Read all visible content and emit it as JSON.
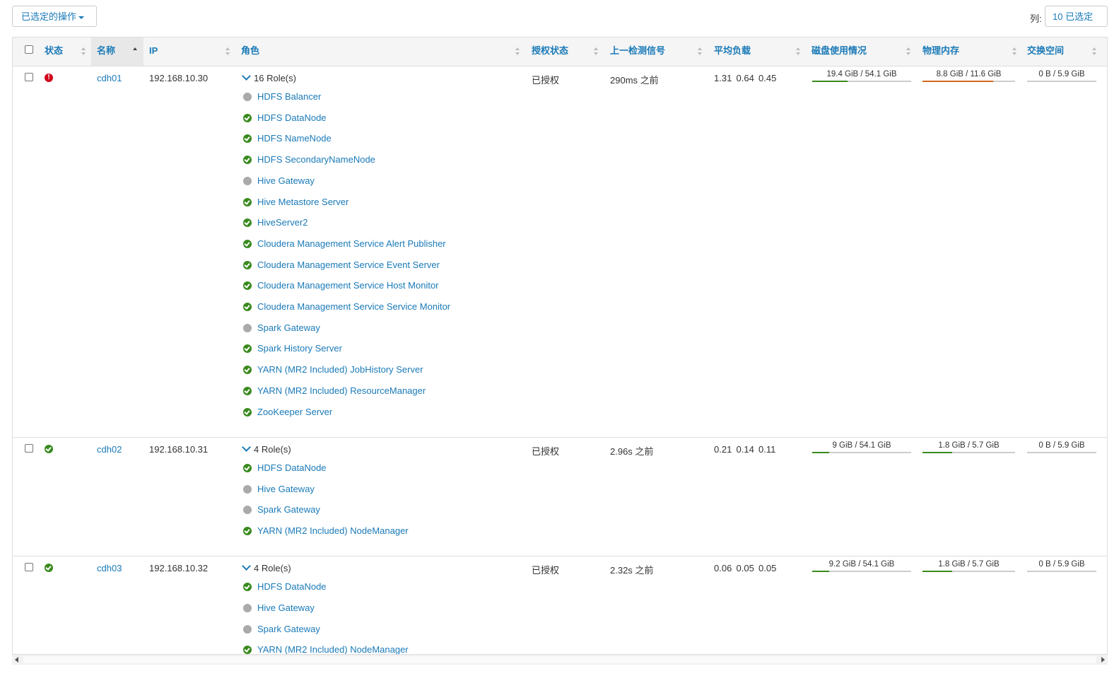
{
  "toolbar": {
    "actions_label": "已选定的操作",
    "columns_label": "列:",
    "columns_button": "10 已选定"
  },
  "headers": {
    "status": "状态",
    "name": "名称",
    "ip": "IP",
    "roles": "角色",
    "auth": "授权状态",
    "heartbeat": "上一检测信号",
    "load": "平均负载",
    "disk": "磁盘使用情况",
    "memory": "物理内存",
    "swap": "交换空间"
  },
  "colors": {
    "link": "#1a7ab8",
    "ok": "#3a8a1e",
    "error": "#d0021b",
    "inactive": "#aaaaaa",
    "bar_green": "#3a8a1e",
    "bar_orange": "#d2691e"
  },
  "hosts": [
    {
      "status": "error",
      "name": "cdh01",
      "ip": "192.168.10.30",
      "roles_summary": "16 Role(s)",
      "roles": [
        {
          "name": "HDFS Balancer",
          "state": "gray"
        },
        {
          "name": "HDFS DataNode",
          "state": "ok"
        },
        {
          "name": "HDFS NameNode",
          "state": "ok"
        },
        {
          "name": "HDFS SecondaryNameNode",
          "state": "ok"
        },
        {
          "name": "Hive Gateway",
          "state": "gray"
        },
        {
          "name": "Hive Metastore Server",
          "state": "ok"
        },
        {
          "name": "HiveServer2",
          "state": "ok"
        },
        {
          "name": "Cloudera Management Service Alert Publisher",
          "state": "ok"
        },
        {
          "name": "Cloudera Management Service Event Server",
          "state": "ok"
        },
        {
          "name": "Cloudera Management Service Host Monitor",
          "state": "ok"
        },
        {
          "name": "Cloudera Management Service Service Monitor",
          "state": "ok"
        },
        {
          "name": "Spark Gateway",
          "state": "gray"
        },
        {
          "name": "Spark History Server",
          "state": "ok"
        },
        {
          "name": "YARN (MR2 Included) JobHistory Server",
          "state": "ok"
        },
        {
          "name": "YARN (MR2 Included) ResourceManager",
          "state": "ok"
        },
        {
          "name": "ZooKeeper Server",
          "state": "ok"
        }
      ],
      "auth": "已授权",
      "heartbeat": "290ms 之前",
      "load": [
        "1.31",
        "0.64",
        "0.45"
      ],
      "disk": {
        "text": "19.4 GiB / 54.1 GiB",
        "fraction": 0.36,
        "color": "#3a8a1e"
      },
      "memory": {
        "text": "8.8 GiB / 11.6 GiB",
        "fraction": 0.76,
        "color": "#d2691e"
      },
      "swap": {
        "text": "0 B / 5.9 GiB",
        "fraction": 0.0,
        "color": "#3a8a1e"
      }
    },
    {
      "status": "ok",
      "name": "cdh02",
      "ip": "192.168.10.31",
      "roles_summary": "4 Role(s)",
      "roles": [
        {
          "name": "HDFS DataNode",
          "state": "ok"
        },
        {
          "name": "Hive Gateway",
          "state": "gray"
        },
        {
          "name": "Spark Gateway",
          "state": "gray"
        },
        {
          "name": "YARN (MR2 Included) NodeManager",
          "state": "ok"
        }
      ],
      "auth": "已授权",
      "heartbeat": "2.96s 之前",
      "load": [
        "0.21",
        "0.14",
        "0.11"
      ],
      "disk": {
        "text": "9 GiB / 54.1 GiB",
        "fraction": 0.17,
        "color": "#3a8a1e"
      },
      "memory": {
        "text": "1.8 GiB / 5.7 GiB",
        "fraction": 0.32,
        "color": "#3a8a1e"
      },
      "swap": {
        "text": "0 B / 5.9 GiB",
        "fraction": 0.0,
        "color": "#3a8a1e"
      }
    },
    {
      "status": "ok",
      "name": "cdh03",
      "ip": "192.168.10.32",
      "roles_summary": "4 Role(s)",
      "roles": [
        {
          "name": "HDFS DataNode",
          "state": "ok"
        },
        {
          "name": "Hive Gateway",
          "state": "gray"
        },
        {
          "name": "Spark Gateway",
          "state": "gray"
        },
        {
          "name": "YARN (MR2 Included) NodeManager",
          "state": "ok"
        }
      ],
      "auth": "已授权",
      "heartbeat": "2.32s 之前",
      "load": [
        "0.06",
        "0.05",
        "0.05"
      ],
      "disk": {
        "text": "9.2 GiB / 54.1 GiB",
        "fraction": 0.17,
        "color": "#3a8a1e"
      },
      "memory": {
        "text": "1.8 GiB / 5.7 GiB",
        "fraction": 0.32,
        "color": "#3a8a1e"
      },
      "swap": {
        "text": "0 B / 5.9 GiB",
        "fraction": 0.0,
        "color": "#3a8a1e"
      }
    }
  ]
}
